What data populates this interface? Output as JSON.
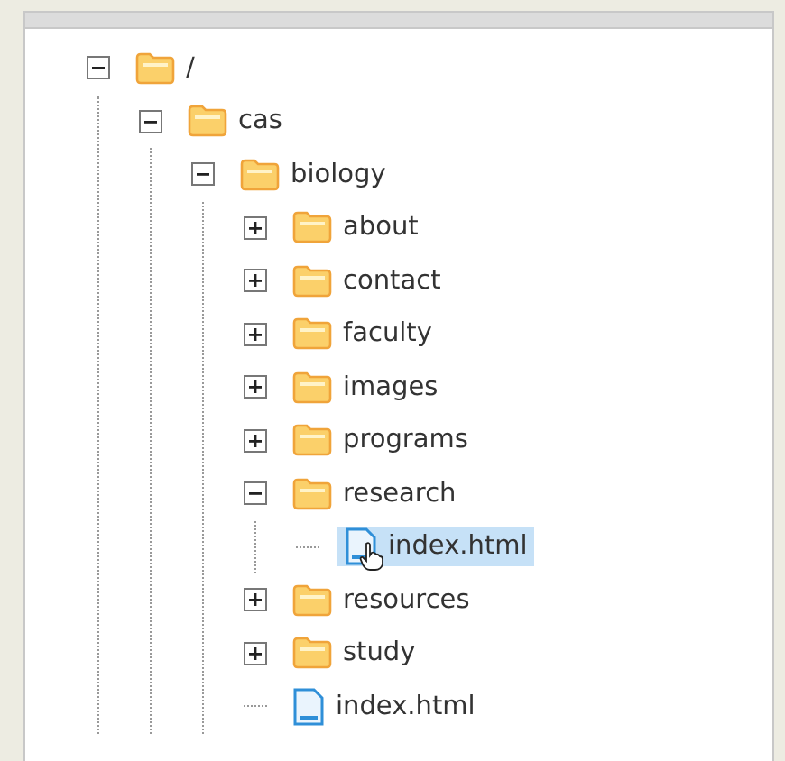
{
  "tree": [
    {
      "kind": "folder",
      "label": "/",
      "expanded": true,
      "children": [
        {
          "kind": "folder",
          "label": "cas",
          "expanded": true,
          "children": [
            {
              "kind": "folder",
              "label": "biology",
              "expanded": true,
              "children": [
                {
                  "kind": "folder",
                  "label": "about",
                  "expanded": false
                },
                {
                  "kind": "folder",
                  "label": "contact",
                  "expanded": false
                },
                {
                  "kind": "folder",
                  "label": "faculty",
                  "expanded": false
                },
                {
                  "kind": "folder",
                  "label": "images",
                  "expanded": false
                },
                {
                  "kind": "folder",
                  "label": "programs",
                  "expanded": false
                },
                {
                  "kind": "folder",
                  "label": "research",
                  "expanded": true,
                  "children": [
                    {
                      "kind": "file",
                      "label": "index.html",
                      "selected": true
                    }
                  ]
                },
                {
                  "kind": "folder",
                  "label": "resources",
                  "expanded": false
                },
                {
                  "kind": "folder",
                  "label": "study",
                  "expanded": false
                },
                {
                  "kind": "file",
                  "label": "index.html",
                  "selected": false
                }
              ]
            }
          ]
        }
      ]
    }
  ]
}
